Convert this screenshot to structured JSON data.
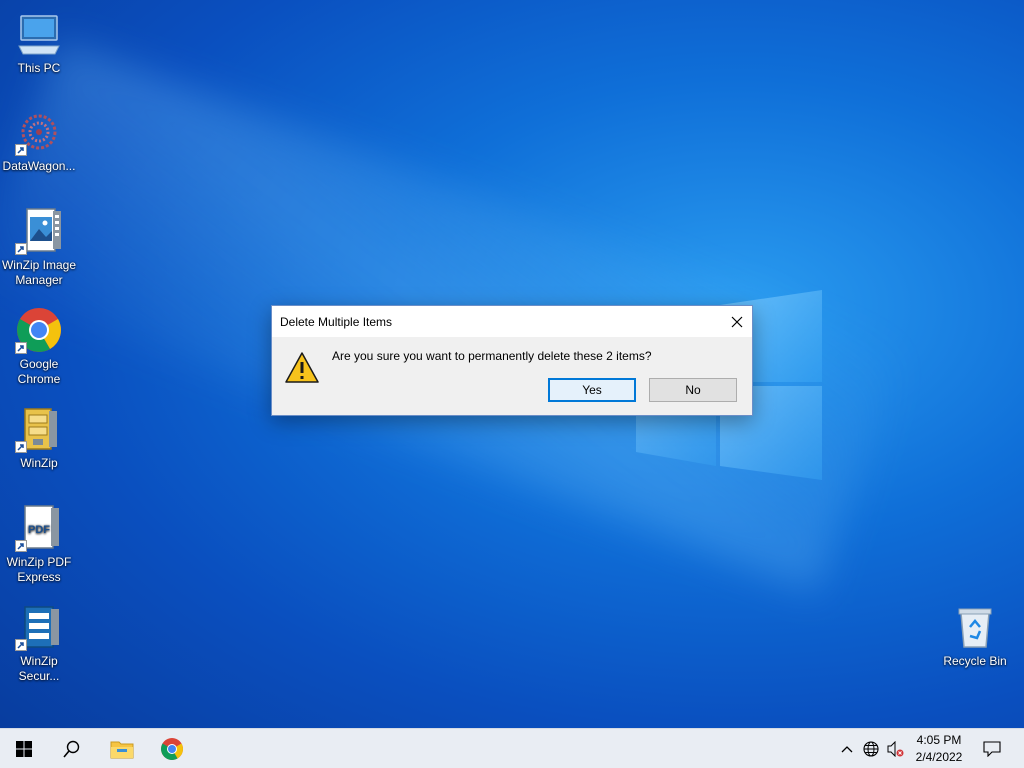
{
  "desktop": {
    "icons": [
      {
        "label": "This PC",
        "icon": "computer-icon"
      },
      {
        "label": "DataWagon...",
        "icon": "datawagon-icon"
      },
      {
        "label": "WinZip Image Manager",
        "icon": "winzip-image-manager-icon"
      },
      {
        "label": "Google Chrome",
        "icon": "chrome-icon"
      },
      {
        "label": "WinZip",
        "icon": "winzip-icon"
      },
      {
        "label": "WinZip PDF Express",
        "icon": "winzip-pdf-icon"
      },
      {
        "label": "WinZip Secur...",
        "icon": "winzip-secure-icon"
      },
      {
        "label": "Recycle Bin",
        "icon": "recycle-bin-icon"
      }
    ]
  },
  "dialog": {
    "title": "Delete Multiple Items",
    "message": "Are you sure you want to permanently delete these 2 items?",
    "yes_label": "Yes",
    "no_label": "No",
    "icon": "warning-icon"
  },
  "taskbar": {
    "items": [
      {
        "icon": "windows-start-icon"
      },
      {
        "icon": "search-icon"
      },
      {
        "icon": "file-explorer-icon"
      },
      {
        "icon": "chrome-icon"
      }
    ],
    "tray": {
      "icons": [
        "chevron-up-icon",
        "network-icon",
        "volume-muted-icon",
        "notification-icon"
      ],
      "time": "4:05 PM",
      "date": "2/4/2022"
    }
  },
  "colors": {
    "accent": "#0078d7",
    "warning": "#f6c21c",
    "desktop_blue": "#0f6fd8"
  }
}
